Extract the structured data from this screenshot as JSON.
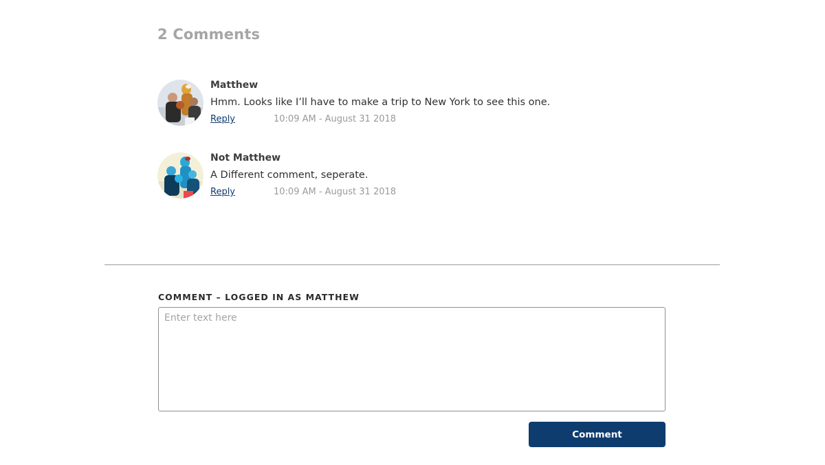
{
  "comments_section": {
    "heading": "2 Comments",
    "comments": [
      {
        "author": "Matthew",
        "text": "Hmm. Looks like I’ll have to make a trip to New York to see this one.",
        "reply_label": "Reply",
        "timestamp": "10:09 AM - August 31 2018",
        "avatar_icon": "user-avatar-photo"
      },
      {
        "author": "Not Matthew",
        "text": "A Different comment, seperate.",
        "reply_label": "Reply",
        "timestamp": "10:09 AM - August 31 2018",
        "avatar_icon": "user-avatar-photo-blue-tint"
      }
    ]
  },
  "comment_form": {
    "label": "COMMENT – LOGGED IN AS MATTHEW",
    "placeholder": "Enter text here",
    "value": "",
    "submit_label": "Comment"
  },
  "colors": {
    "accent": "#0f3c6e",
    "heading_gray": "#a5a5a5",
    "timestamp_gray": "#9a9a9a"
  }
}
